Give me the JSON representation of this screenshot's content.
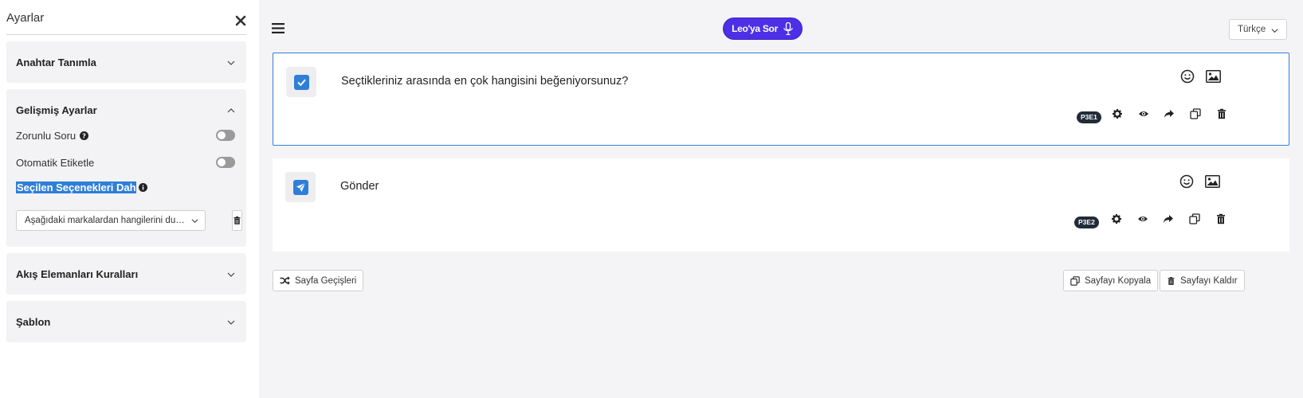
{
  "sidebar": {
    "title": "Ayarlar",
    "close_icon": "close-x-icon",
    "panels": [
      {
        "title": "Anahtar Tanımla",
        "state": "collapsed"
      },
      {
        "title": "Gelişmiş Ayarlar",
        "state": "expanded"
      },
      {
        "title": "Akış Elemanları Kuralları",
        "state": "collapsed"
      },
      {
        "title": "Şablon",
        "state": "collapsed"
      }
    ],
    "advanced": {
      "required_label": "Zorunlu Soru",
      "required_on": false,
      "auto_tag_label": "Otomatik Etiketle",
      "auto_tag_on": false,
      "include_label": "Seçilen Seçenekleri Dahil Et",
      "include_select_value": "Aşağıdaki markalardan hangilerini duydunuz?"
    }
  },
  "header": {
    "ask_leo_label": "Leo'ya Sor",
    "language": "Türkçe"
  },
  "questions": [
    {
      "text": "Seçtikleriniz arasında en çok hangisini beğeniyorsunuz?",
      "badge": "P3E1",
      "icon": "checkbox-icon",
      "selected": true
    },
    {
      "text": "Gönder",
      "badge": "P3E2",
      "icon": "send-icon",
      "selected": false
    }
  ],
  "footer": {
    "page_transitions": "Sayfa Geçişleri",
    "copy_page": "Sayfayı Kopyala",
    "remove_page": "Sayfayı Kaldır"
  },
  "colors": {
    "accent": "#2f7fd8",
    "leo_button": "#4d30e6",
    "badge": "#222b38",
    "main_bg": "#f4f4f7"
  }
}
